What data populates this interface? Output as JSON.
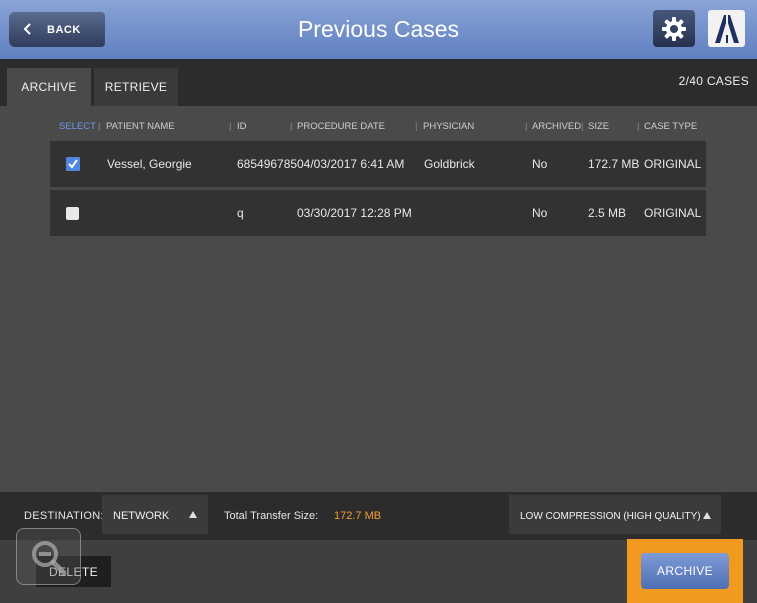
{
  "header": {
    "back_label": "BACK",
    "title": "Previous Cases",
    "settings_icon": "gear-icon",
    "logo_icon": "brand-logo-icon",
    "accent_color": "#6f8fcf"
  },
  "tabs": {
    "archive_label": "ARCHIVE",
    "retrieve_label": "RETRIEVE",
    "active": "ARCHIVE",
    "case_count": "2/40 CASES"
  },
  "table": {
    "columns": [
      "SELECT",
      "PATIENT NAME",
      "ID",
      "PROCEDURE DATE",
      "PHYSICIAN",
      "ARCHIVED",
      "SIZE",
      "CASE TYPE"
    ],
    "rows": [
      {
        "selected": true,
        "patient_name": "Vessel, Georgie",
        "id": "685496785",
        "procedure_date": "04/03/2017  6:41 AM",
        "physician": "Goldbrick",
        "archived": "No",
        "size": "172.7 MB",
        "case_type": "ORIGINAL"
      },
      {
        "selected": false,
        "patient_name": "",
        "id": "q",
        "procedure_date": "03/30/2017  12:28 PM",
        "physician": "",
        "archived": "No",
        "size": "2.5 MB",
        "case_type": "ORIGINAL"
      }
    ]
  },
  "destination": {
    "label": "DESTINATION:",
    "value": "NETWORK",
    "transfer_label": "Total Transfer Size:",
    "transfer_value": "172.7 MB",
    "transfer_color": "#f0a030",
    "compression_value": "LOW COMPRESSION (HIGH QUALITY)"
  },
  "actions": {
    "delete_label": "DELETE",
    "archive_label": "ARCHIVE",
    "zoom_icon": "zoom-out-icon",
    "highlight_color": "#f29a1f"
  }
}
